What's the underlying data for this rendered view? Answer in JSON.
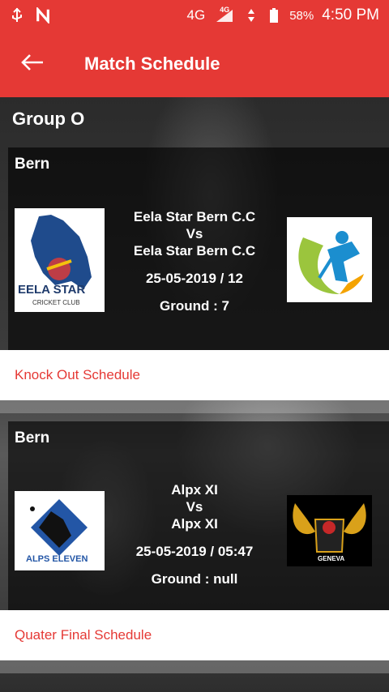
{
  "status_bar": {
    "network": "4G",
    "network_small": "4G",
    "battery": "58%",
    "time": "4:50 PM"
  },
  "app_bar": {
    "title": "Match Schedule"
  },
  "group": {
    "title": "Group O"
  },
  "matches": [
    {
      "location": "Bern",
      "team1": "Eela Star Bern C.C",
      "vs": "Vs",
      "team2": "Eela Star Bern C.C",
      "date": "25-05-2019 / 12",
      "ground": "Ground : 7",
      "logo_left_text": "EELA STAR",
      "logo_left_subtext": "CRICKET CLUB",
      "link": "Knock Out Schedule"
    },
    {
      "location": "Bern",
      "team1": "Alpx XI",
      "vs": "Vs",
      "team2": "Alpx XI",
      "date": "25-05-2019 / 05:47",
      "ground": "Ground : null",
      "logo_left_text": "ALPS ELEVEN",
      "logo_right_text": "GENEVA",
      "link": "Quater Final Schedule"
    }
  ],
  "colors": {
    "accent": "#e53935",
    "text_light": "#ffffff"
  }
}
